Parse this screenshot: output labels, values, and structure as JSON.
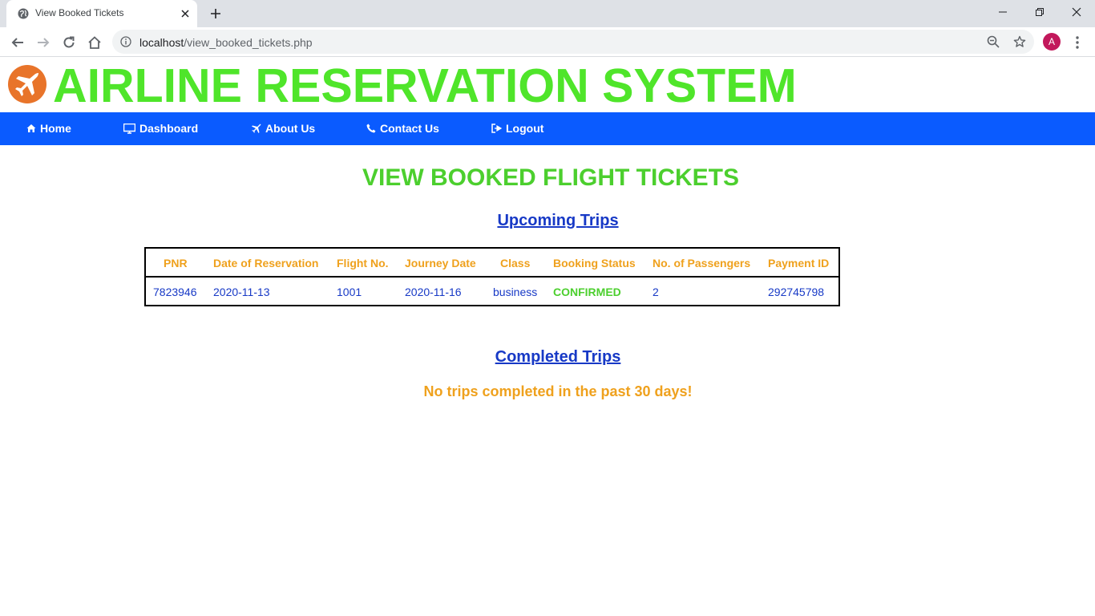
{
  "browser": {
    "tab_title": "View Booked Tickets",
    "url_host": "localhost",
    "url_path": "/view_booked_tickets.php",
    "avatar_letter": "A",
    "icons": [
      "globe-icon",
      "close-icon",
      "plus-icon",
      "back-icon",
      "forward-icon",
      "reload-icon",
      "home-icon",
      "info-icon",
      "zoom-icon",
      "star-icon",
      "menu-icon"
    ]
  },
  "site": {
    "title": "AIRLINE RESERVATION SYSTEM",
    "accent_color": "#4fe52a",
    "nav_color": "#0a5bff"
  },
  "nav": {
    "home": "Home",
    "dashboard": "Dashboard",
    "about": "About Us",
    "contact": "Contact Us",
    "logout": "Logout"
  },
  "page": {
    "heading": "VIEW BOOKED FLIGHT TICKETS",
    "upcoming_heading": "Upcoming Trips",
    "completed_heading": "Completed Trips",
    "no_completed_msg": "No trips completed in the past 30 days!"
  },
  "table": {
    "headers": [
      "PNR",
      "Date of Reservation",
      "Flight No.",
      "Journey Date",
      "Class",
      "Booking Status",
      "No. of Passengers",
      "Payment ID"
    ],
    "rows": [
      [
        "7823946",
        "2020-11-13",
        "1001",
        "2020-11-16",
        "business",
        "CONFIRMED",
        "2",
        "292745798"
      ]
    ]
  }
}
